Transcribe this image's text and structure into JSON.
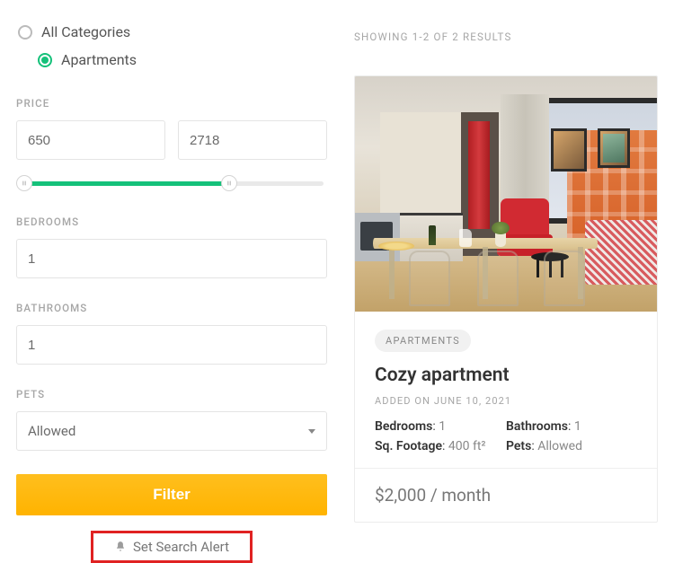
{
  "categories": {
    "all": "All Categories",
    "apartments": "Apartments"
  },
  "labels": {
    "price": "PRICE",
    "bedrooms": "BEDROOMS",
    "bathrooms": "BATHROOMS",
    "pets": "PETS"
  },
  "filters": {
    "price_min": "650",
    "price_max": "2718",
    "bedrooms": "1",
    "bathrooms": "1",
    "pets_selected": "Allowed"
  },
  "buttons": {
    "filter": "Filter",
    "set_alert": "Set Search Alert"
  },
  "results": {
    "showing": "SHOWING 1-2 OF 2 RESULTS"
  },
  "listing": {
    "tag": "APARTMENTS",
    "title": "Cozy apartment",
    "added": "ADDED ON JUNE 10, 2021",
    "meta_labels": {
      "bedrooms": "Bedrooms",
      "bathrooms": "Bathrooms",
      "sqft": "Sq. Footage",
      "pets": "Pets"
    },
    "bedrooms": "1",
    "bathrooms": "1",
    "sqft": "400 ft²",
    "pets": "Allowed",
    "price": "$2,000 / month"
  }
}
